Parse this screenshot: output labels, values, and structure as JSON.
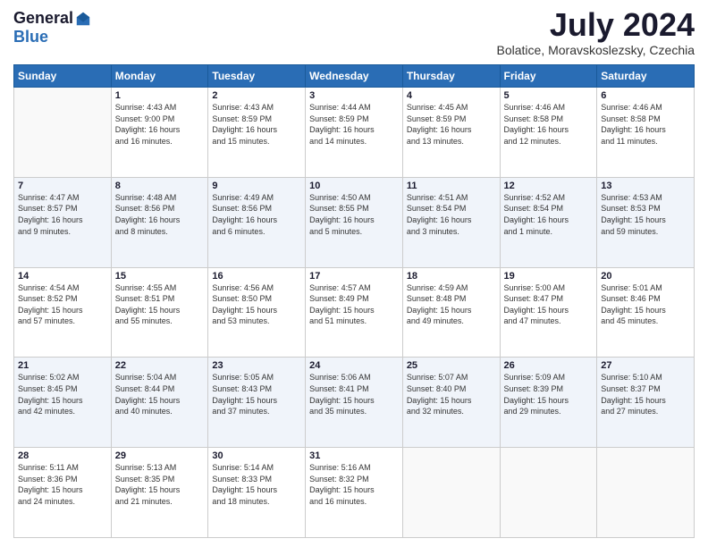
{
  "header": {
    "logo_general": "General",
    "logo_blue": "Blue",
    "month": "July 2024",
    "location": "Bolatice, Moravskoslezsky, Czechia"
  },
  "days_of_week": [
    "Sunday",
    "Monday",
    "Tuesday",
    "Wednesday",
    "Thursday",
    "Friday",
    "Saturday"
  ],
  "weeks": [
    [
      {
        "day": "",
        "info": ""
      },
      {
        "day": "1",
        "info": "Sunrise: 4:43 AM\nSunset: 9:00 PM\nDaylight: 16 hours\nand 16 minutes."
      },
      {
        "day": "2",
        "info": "Sunrise: 4:43 AM\nSunset: 8:59 PM\nDaylight: 16 hours\nand 15 minutes."
      },
      {
        "day": "3",
        "info": "Sunrise: 4:44 AM\nSunset: 8:59 PM\nDaylight: 16 hours\nand 14 minutes."
      },
      {
        "day": "4",
        "info": "Sunrise: 4:45 AM\nSunset: 8:59 PM\nDaylight: 16 hours\nand 13 minutes."
      },
      {
        "day": "5",
        "info": "Sunrise: 4:46 AM\nSunset: 8:58 PM\nDaylight: 16 hours\nand 12 minutes."
      },
      {
        "day": "6",
        "info": "Sunrise: 4:46 AM\nSunset: 8:58 PM\nDaylight: 16 hours\nand 11 minutes."
      }
    ],
    [
      {
        "day": "7",
        "info": "Sunrise: 4:47 AM\nSunset: 8:57 PM\nDaylight: 16 hours\nand 9 minutes."
      },
      {
        "day": "8",
        "info": "Sunrise: 4:48 AM\nSunset: 8:56 PM\nDaylight: 16 hours\nand 8 minutes."
      },
      {
        "day": "9",
        "info": "Sunrise: 4:49 AM\nSunset: 8:56 PM\nDaylight: 16 hours\nand 6 minutes."
      },
      {
        "day": "10",
        "info": "Sunrise: 4:50 AM\nSunset: 8:55 PM\nDaylight: 16 hours\nand 5 minutes."
      },
      {
        "day": "11",
        "info": "Sunrise: 4:51 AM\nSunset: 8:54 PM\nDaylight: 16 hours\nand 3 minutes."
      },
      {
        "day": "12",
        "info": "Sunrise: 4:52 AM\nSunset: 8:54 PM\nDaylight: 16 hours\nand 1 minute."
      },
      {
        "day": "13",
        "info": "Sunrise: 4:53 AM\nSunset: 8:53 PM\nDaylight: 15 hours\nand 59 minutes."
      }
    ],
    [
      {
        "day": "14",
        "info": "Sunrise: 4:54 AM\nSunset: 8:52 PM\nDaylight: 15 hours\nand 57 minutes."
      },
      {
        "day": "15",
        "info": "Sunrise: 4:55 AM\nSunset: 8:51 PM\nDaylight: 15 hours\nand 55 minutes."
      },
      {
        "day": "16",
        "info": "Sunrise: 4:56 AM\nSunset: 8:50 PM\nDaylight: 15 hours\nand 53 minutes."
      },
      {
        "day": "17",
        "info": "Sunrise: 4:57 AM\nSunset: 8:49 PM\nDaylight: 15 hours\nand 51 minutes."
      },
      {
        "day": "18",
        "info": "Sunrise: 4:59 AM\nSunset: 8:48 PM\nDaylight: 15 hours\nand 49 minutes."
      },
      {
        "day": "19",
        "info": "Sunrise: 5:00 AM\nSunset: 8:47 PM\nDaylight: 15 hours\nand 47 minutes."
      },
      {
        "day": "20",
        "info": "Sunrise: 5:01 AM\nSunset: 8:46 PM\nDaylight: 15 hours\nand 45 minutes."
      }
    ],
    [
      {
        "day": "21",
        "info": "Sunrise: 5:02 AM\nSunset: 8:45 PM\nDaylight: 15 hours\nand 42 minutes."
      },
      {
        "day": "22",
        "info": "Sunrise: 5:04 AM\nSunset: 8:44 PM\nDaylight: 15 hours\nand 40 minutes."
      },
      {
        "day": "23",
        "info": "Sunrise: 5:05 AM\nSunset: 8:43 PM\nDaylight: 15 hours\nand 37 minutes."
      },
      {
        "day": "24",
        "info": "Sunrise: 5:06 AM\nSunset: 8:41 PM\nDaylight: 15 hours\nand 35 minutes."
      },
      {
        "day": "25",
        "info": "Sunrise: 5:07 AM\nSunset: 8:40 PM\nDaylight: 15 hours\nand 32 minutes."
      },
      {
        "day": "26",
        "info": "Sunrise: 5:09 AM\nSunset: 8:39 PM\nDaylight: 15 hours\nand 29 minutes."
      },
      {
        "day": "27",
        "info": "Sunrise: 5:10 AM\nSunset: 8:37 PM\nDaylight: 15 hours\nand 27 minutes."
      }
    ],
    [
      {
        "day": "28",
        "info": "Sunrise: 5:11 AM\nSunset: 8:36 PM\nDaylight: 15 hours\nand 24 minutes."
      },
      {
        "day": "29",
        "info": "Sunrise: 5:13 AM\nSunset: 8:35 PM\nDaylight: 15 hours\nand 21 minutes."
      },
      {
        "day": "30",
        "info": "Sunrise: 5:14 AM\nSunset: 8:33 PM\nDaylight: 15 hours\nand 18 minutes."
      },
      {
        "day": "31",
        "info": "Sunrise: 5:16 AM\nSunset: 8:32 PM\nDaylight: 15 hours\nand 16 minutes."
      },
      {
        "day": "",
        "info": ""
      },
      {
        "day": "",
        "info": ""
      },
      {
        "day": "",
        "info": ""
      }
    ]
  ]
}
